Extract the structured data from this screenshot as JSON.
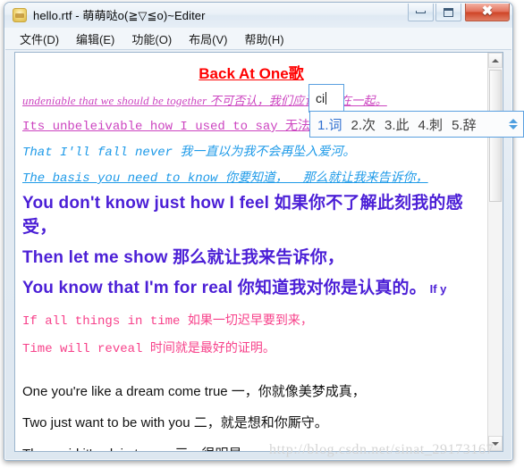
{
  "window": {
    "title": "hello.rtf - 萌萌哒o(≧▽≦o)~Editer",
    "icon": "honey-pot-icon",
    "buttons": {
      "minimize": "–",
      "maximize": "□",
      "close": "✕"
    }
  },
  "menu": {
    "items": [
      {
        "label": "文件(D)",
        "name": "menu-file"
      },
      {
        "label": "编辑(E)",
        "name": "menu-edit"
      },
      {
        "label": "功能(O)",
        "name": "menu-function"
      },
      {
        "label": "布局(V)",
        "name": "menu-layout"
      },
      {
        "label": "帮助(H)",
        "name": "menu-help"
      }
    ]
  },
  "document": {
    "title": "Back At One歌",
    "title_color": "#ff0000",
    "lines": [
      {
        "text": "undeniable that we should be together 不可否认，我们应该厮守在一起。",
        "color": "#cc44c0",
        "style": "serif-italic-underline"
      },
      {
        "text": "Its unbeleivable how I used to say 无法相信我曾经说过，",
        "color": "#cc44c0",
        "style": "mono-underline"
      },
      {
        "text": "That I'll fall never 我一直以为我不会再坠入爱河。",
        "color": "#1e9ae8",
        "style": "mono-italic"
      },
      {
        "text": "The basis you need to know 你要知道，  那么就让我来告诉你，",
        "color": "#1e9ae8",
        "style": "mono-italic-underline"
      },
      {
        "text": "You don't know just how I feel 如果你不了解此刻我的感受，",
        "color": "#4b1fd6",
        "style": "sans-bold-large"
      },
      {
        "text": "Then let me show 那么就让我来告诉你，",
        "color": "#4b1fd6",
        "style": "sans-bold-large"
      },
      {
        "text": "You know that I'm for real 你知道我对你是认真的。",
        "tail": " If y",
        "color": "#4b1fd6",
        "style": "sans-bold-large"
      },
      {
        "text": "If all things in time 如果一切迟早要到来，",
        "color": "#f7418a",
        "style": "mono"
      },
      {
        "text": "Time will reveal 时间就是最好的证明。",
        "color": "#f7418a",
        "style": "mono"
      },
      {
        "text": "One you're like a dream come true 一，你就像美梦成真，",
        "color": "#111111",
        "style": "sans"
      },
      {
        "text": "Two just want to be with you 二，就是想和你厮守。",
        "color": "#111111",
        "style": "sans"
      },
      {
        "text": "Three girl it's plain to see 三，很明显",
        "color": "#111111",
        "style": "sans"
      }
    ]
  },
  "ime": {
    "composition": "ci",
    "candidates": [
      "1.词",
      "2.次",
      "3.此",
      "4.刺",
      "5.辞"
    ],
    "accent_color": "#5aa0e0",
    "first_candidate_color": "#2f6fd0"
  },
  "scrollbar": {
    "up_arrow": "scroll-up-arrow",
    "down_arrow": "scroll-down-arrow",
    "thumb": "scroll-thumb"
  },
  "watermark": {
    "text": "http://blog.csdn.net/sinat_29173167"
  }
}
